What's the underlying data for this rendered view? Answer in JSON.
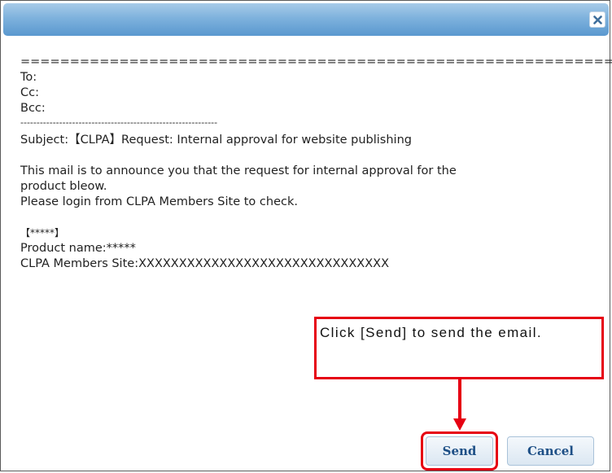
{
  "dialog": {
    "close_icon": "close-x-icon"
  },
  "mail": {
    "separator_top": "============================================================",
    "to": "To:",
    "cc": "Cc:",
    "bcc": "Bcc:",
    "separator_mid": "-------------------------------------------------------------",
    "subject": "Subject:【CLPA】Request: Internal approval for website publishing",
    "body_line1": "This mail is to announce you that the request for internal approval for the",
    "body_line2": "product bleow.",
    "body_line3": "Please login from CLPA Members Site to check.",
    "bracket_line": "【*****】",
    "product_line": "Product name:*****",
    "site_line": "CLPA Members Site:XXXXXXXXXXXXXXXXXXXXXXXXXXXXXXX"
  },
  "callout": {
    "text": "Click [Send] to send the email."
  },
  "buttons": {
    "send": "Send",
    "cancel": "Cancel"
  },
  "colors": {
    "annotation_red": "#e60012",
    "titlebar_blue": "#7eb2dd",
    "button_text": "#1d4f86"
  }
}
